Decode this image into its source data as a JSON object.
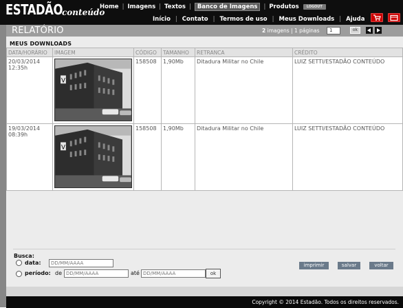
{
  "brand": {
    "line1": "ESTADÃO",
    "line2": "conteúdo"
  },
  "topnav": {
    "items": [
      "Home",
      "Imagens",
      "Textos",
      "Banco de Imagens",
      "Produtos"
    ],
    "active": "Banco de Imagens",
    "logout": "LOGOUT"
  },
  "subnav": {
    "items": [
      "Início",
      "Contato",
      "Termos de uso",
      "Meus Downloads",
      "Ajuda"
    ]
  },
  "report": {
    "title": "RELATÓRIO",
    "images_count": "2",
    "images_label": "imagens",
    "pages_label": "| 1 páginas",
    "page_value": "1",
    "ok_label": "ok"
  },
  "section_title": "MEUS DOWNLOADS",
  "table": {
    "columns": [
      "DATA/HORÁRIO",
      "IMAGEM",
      "CÓDIGO",
      "TAMANHO",
      "RETRANCA",
      "CRÉDITO"
    ],
    "rows": [
      {
        "date": "20/03/2014",
        "time": "12:35h",
        "code": "158508",
        "size": "1,90Mb",
        "retranca": "Ditadura Militar no Chile",
        "credit": "LUIZ SETTI/ESTADÃO CONTEÚDO"
      },
      {
        "date": "19/03/2014",
        "time": "08:39h",
        "code": "158508",
        "size": "1,90Mb",
        "retranca": "Ditadura Militar no Chile",
        "credit": "LUIZ SETTI/ESTADÃO CONTEÚDO"
      }
    ]
  },
  "search": {
    "label": "Busca:",
    "date_label": "data:",
    "period_label": "período:",
    "from_label": "de",
    "to_label": "até",
    "placeholder": "DD/MM/AAAA",
    "ok_label": "ok",
    "buttons": {
      "print": "imprimir",
      "save": "salvar",
      "back": "voltar"
    }
  },
  "footer": {
    "copyright": "Copyright © 2014 Estadão. Todos os direitos reservados."
  },
  "colors": {
    "header_bg": "#0e0e0e",
    "title_bar": "#9c9c9c",
    "cart_red": "#cc0000",
    "action_button": "#6a7a8a"
  },
  "icons": {
    "cart": "shopping-cart-icon",
    "box": "download-box-icon",
    "prev": "prev-page-icon",
    "next": "next-page-icon"
  }
}
